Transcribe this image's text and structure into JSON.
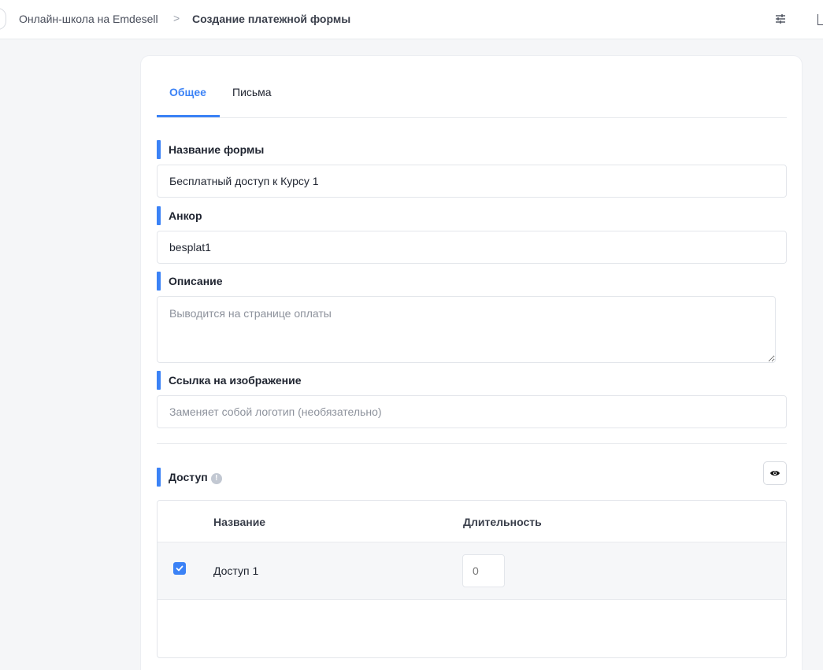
{
  "header": {
    "breadcrumb_root": "Онлайн-школа на Emdesell",
    "breadcrumb_separator": ">",
    "breadcrumb_current": "Создание платежной формы",
    "settings_icon": "sliders-icon"
  },
  "tabs": [
    {
      "label": "Общее",
      "active": true
    },
    {
      "label": "Письма",
      "active": false
    }
  ],
  "form": {
    "name_label": "Название формы",
    "name_value": "Бесплатный доступ к Курсу 1",
    "anchor_label": "Анкор",
    "anchor_value": "besplat1",
    "description_label": "Описание",
    "description_placeholder": "Выводится на странице оплаты",
    "image_label": "Ссылка на изображение",
    "image_placeholder": "Заменяет собой логотип (необязательно)"
  },
  "access": {
    "label": "Доступ",
    "info_icon": "info-icon",
    "eye_icon": "eye-icon",
    "columns": [
      "Название",
      "Длительность"
    ],
    "rows": [
      {
        "checked": true,
        "name": "Доступ 1",
        "duration_placeholder": "0"
      }
    ]
  },
  "colors": {
    "accent": "#3b82f6",
    "background": "#f5f6f8",
    "card": "#ffffff"
  }
}
